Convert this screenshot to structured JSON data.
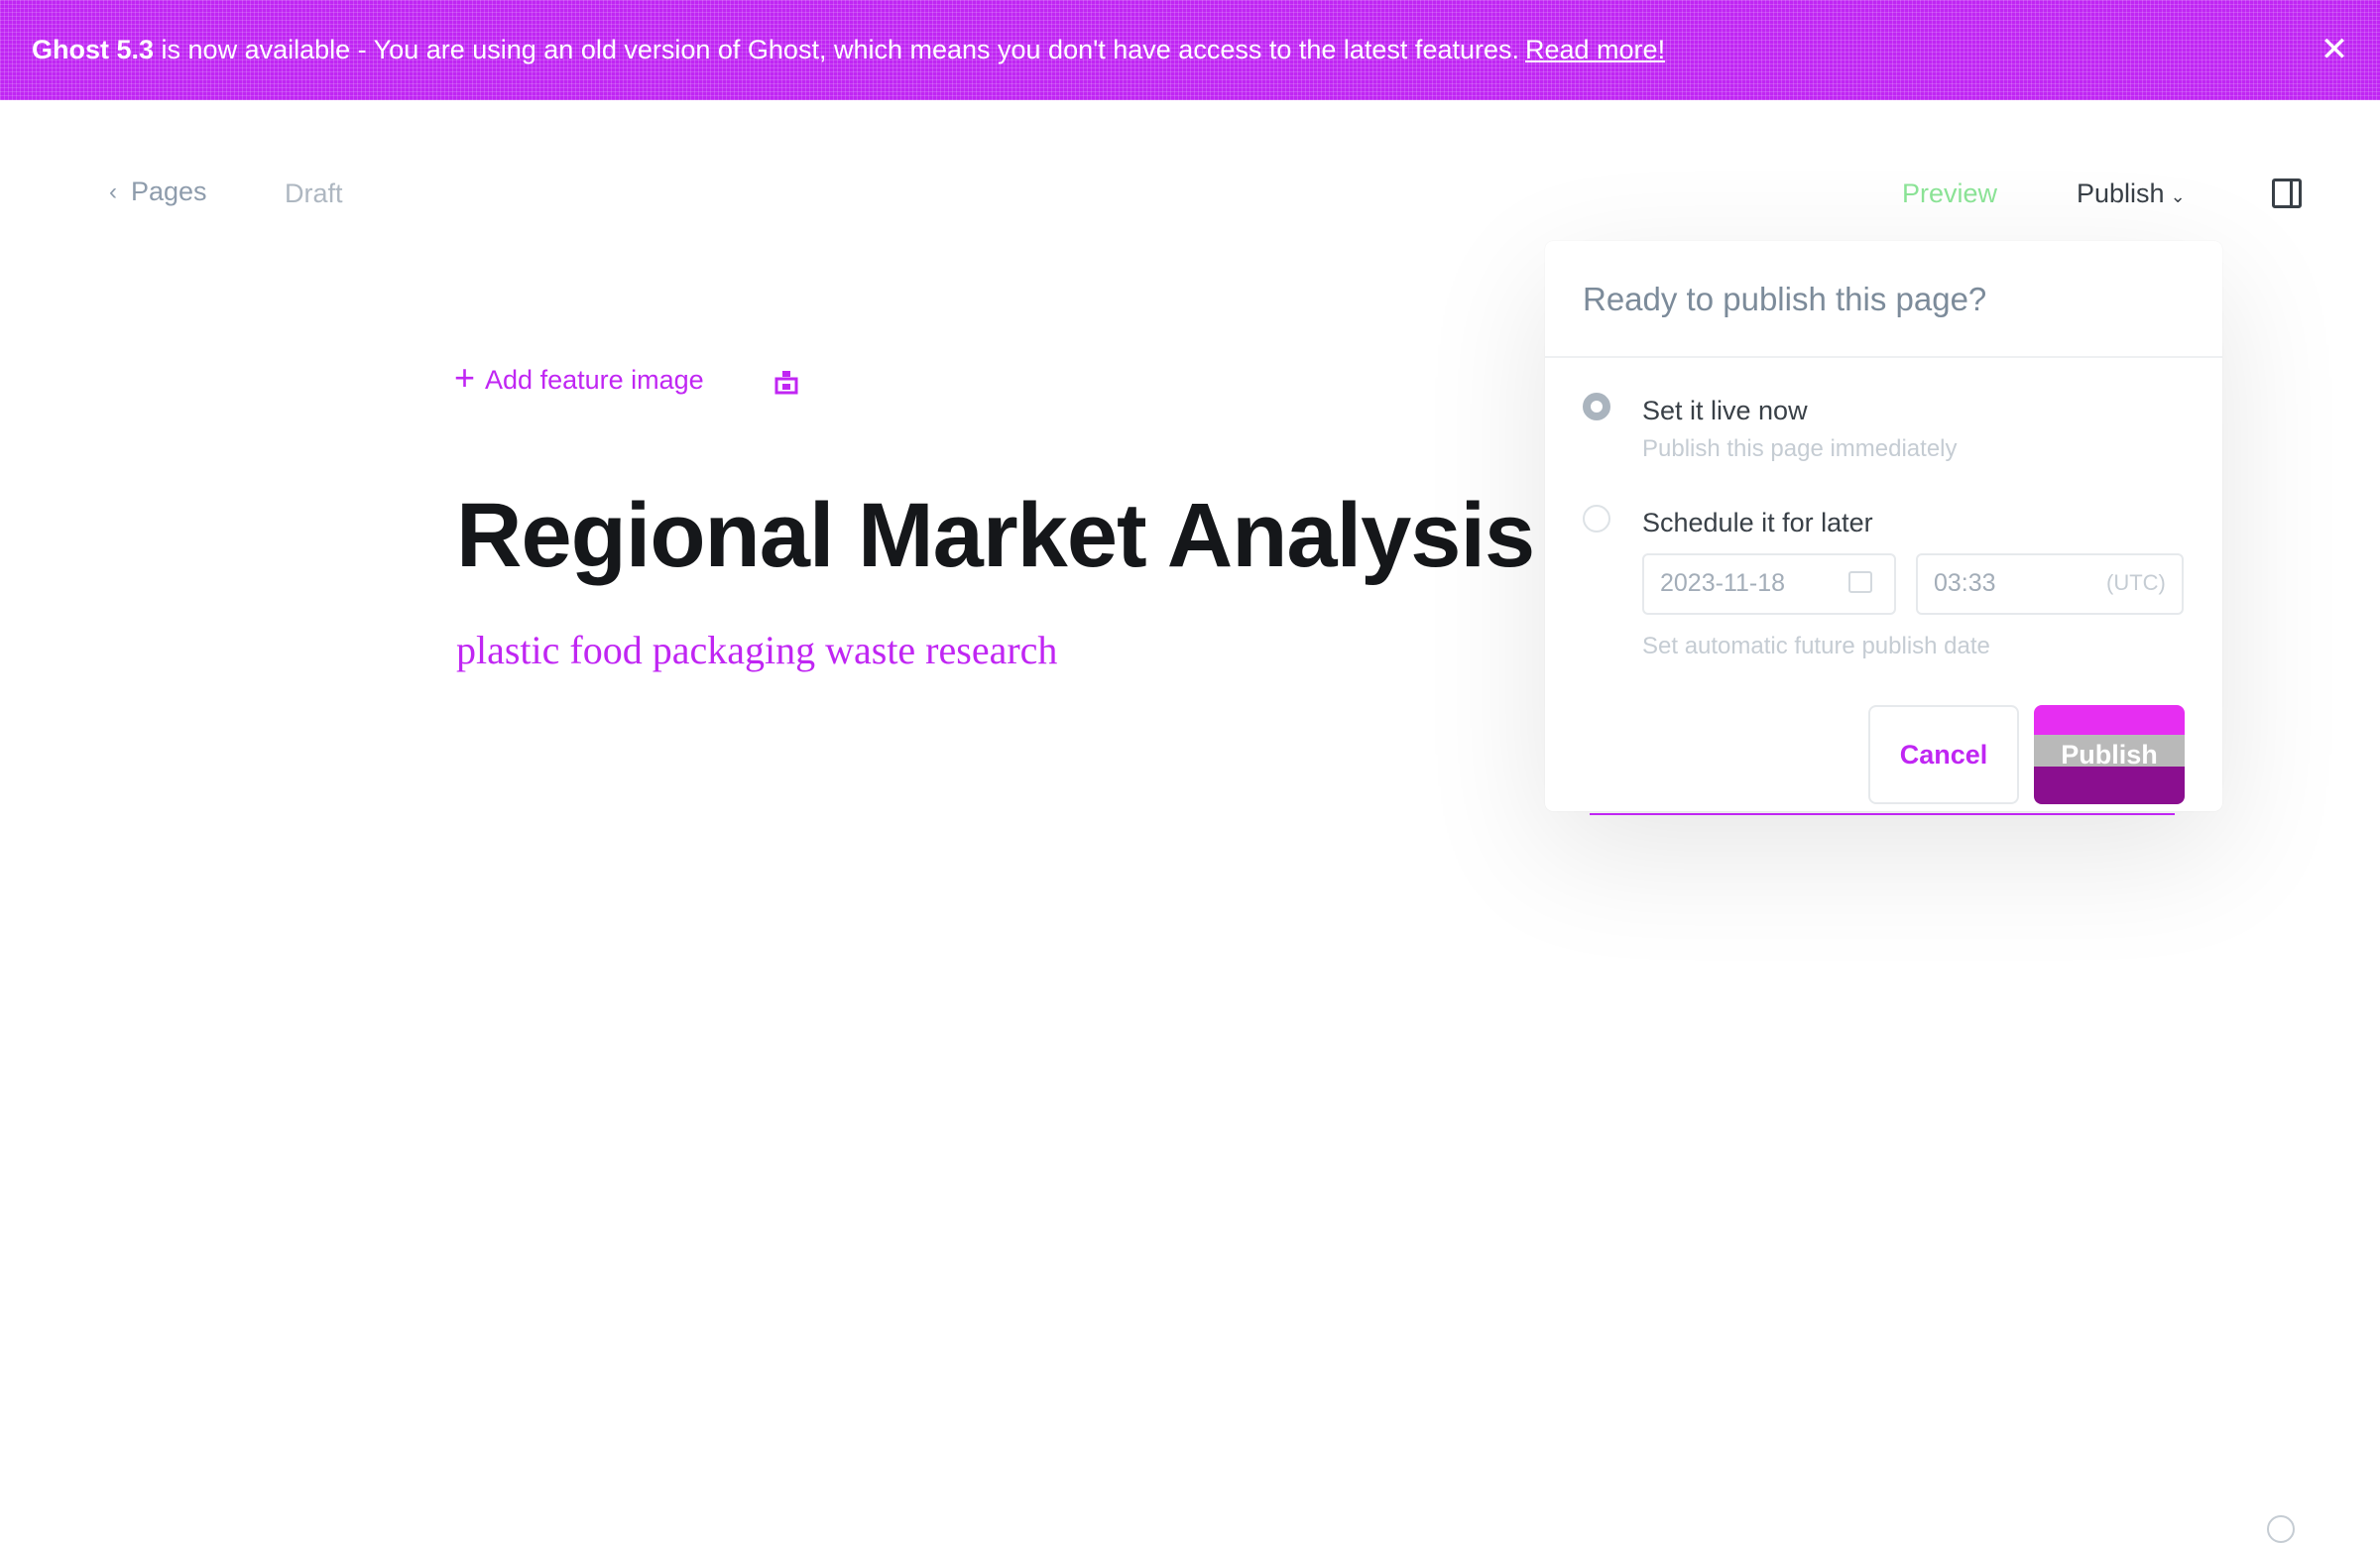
{
  "banner": {
    "version_bold": "Ghost 5.3",
    "message": " is now available - You are using an old version of Ghost, which means you don't have access to the latest features.",
    "link": "Read more!"
  },
  "nav": {
    "back_label": "Pages",
    "status": "Draft",
    "preview": "Preview",
    "publish": "Publish"
  },
  "editor": {
    "add_feature_image": "Add feature image",
    "title": "Regional Market Analysis",
    "excerpt": "plastic food packaging waste research"
  },
  "publish_menu": {
    "header": "Ready to publish this page?",
    "option_now_title": "Set it live now",
    "option_now_desc": "Publish this page immediately",
    "option_later_title": "Schedule it for later",
    "date_value": "2023-11-18",
    "time_value": "03:33",
    "timezone": "(UTC)",
    "option_later_desc": "Set automatic future publish date",
    "cancel": "Cancel",
    "publish": "Publish"
  },
  "colors": {
    "accent": "#c026f3",
    "preview_green": "#30cf43"
  },
  "icons": [
    "chevron-left-icon",
    "close-icon",
    "plus-icon",
    "snippet-icon",
    "chevron-down-icon",
    "sidebar-toggle-icon",
    "calendar-icon",
    "help-icon"
  ]
}
